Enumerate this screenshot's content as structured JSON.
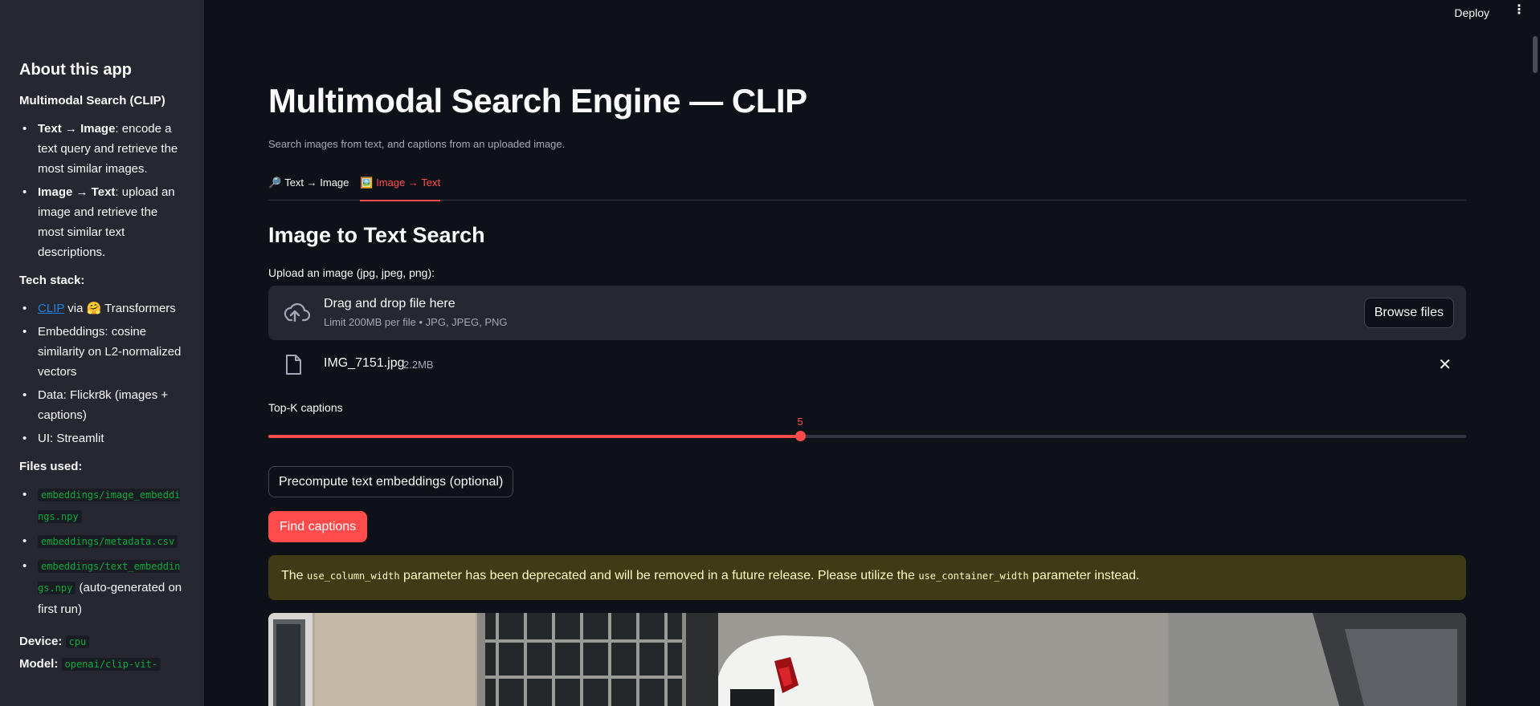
{
  "header": {
    "deploy_label": "Deploy",
    "menu_glyph": "⋮"
  },
  "sidebar": {
    "title": "About this app",
    "subtitle": "Multimodal Search (CLIP)",
    "features": [
      {
        "bold": "Text → Image",
        "text": ": encode a text query and retrieve the most similar images."
      },
      {
        "bold": "Image → Text",
        "text": ": upload an image and retrieve the most similar text descriptions."
      }
    ],
    "tech_stack_label": "Tech stack:",
    "tech": {
      "clip_link": "CLIP",
      "clip_rest": " via 🤗 Transformers",
      "item2": "Embeddings: cosine similarity on L2-normalized vectors",
      "item3": "Data: Flickr8k (images + captions)",
      "item4": "UI: Streamlit"
    },
    "files_label": "Files used:",
    "files": {
      "f1": "embeddings/image_embeddings.npy",
      "f2": "embeddings/metadata.csv",
      "f3": "embeddings/text_embeddings.npy",
      "f3_note": " (auto-generated on first run)"
    },
    "device_label": "Device:",
    "device_value": "cpu",
    "model_label": "Model:",
    "model_value": "openai/clip-vit-"
  },
  "main": {
    "title": "Multimodal Search Engine — CLIP",
    "subtitle": "Search images from text, and captions from an uploaded image.",
    "tabs": [
      {
        "icon": "🔎",
        "label": "Text → Image",
        "active": false
      },
      {
        "icon": "🖼️",
        "label": "Image → Text",
        "active": true
      }
    ],
    "section_title": "Image to Text Search",
    "upload": {
      "label": "Upload an image (jpg, jpeg, png):",
      "drop_text": "Drag and drop file here",
      "limit_text": "Limit 200MB per file • JPG, JPEG, PNG",
      "browse_label": "Browse files",
      "file_name": "IMG_7151.jpg",
      "file_size": "2.2MB",
      "remove_glyph": "✕"
    },
    "slider": {
      "label": "Top-K captions",
      "value": 5,
      "value_text": "5",
      "min": 1,
      "max": 10,
      "fraction": 0.444
    },
    "precompute_label": "Precompute text embeddings (optional)",
    "find_label": "Find captions",
    "warning": {
      "p1": "The ",
      "c1": "use_column_width",
      "p2": " parameter has been deprecated and will be removed in a future release. Please utilize the ",
      "c2": "use_container_width",
      "p3": " parameter instead."
    }
  },
  "colors": {
    "background": "#0e1117",
    "sidebar": "#262730",
    "accent": "#ff4b4b",
    "warning_bg": "#3e3b16",
    "warning_text": "#ffffc2",
    "link": "#1c83e1",
    "code": "#09ab3b"
  },
  "icons": [
    "cloud-upload-icon",
    "file-icon",
    "close-icon",
    "kebab-menu-icon",
    "magnifier-icon",
    "picture-icon"
  ]
}
